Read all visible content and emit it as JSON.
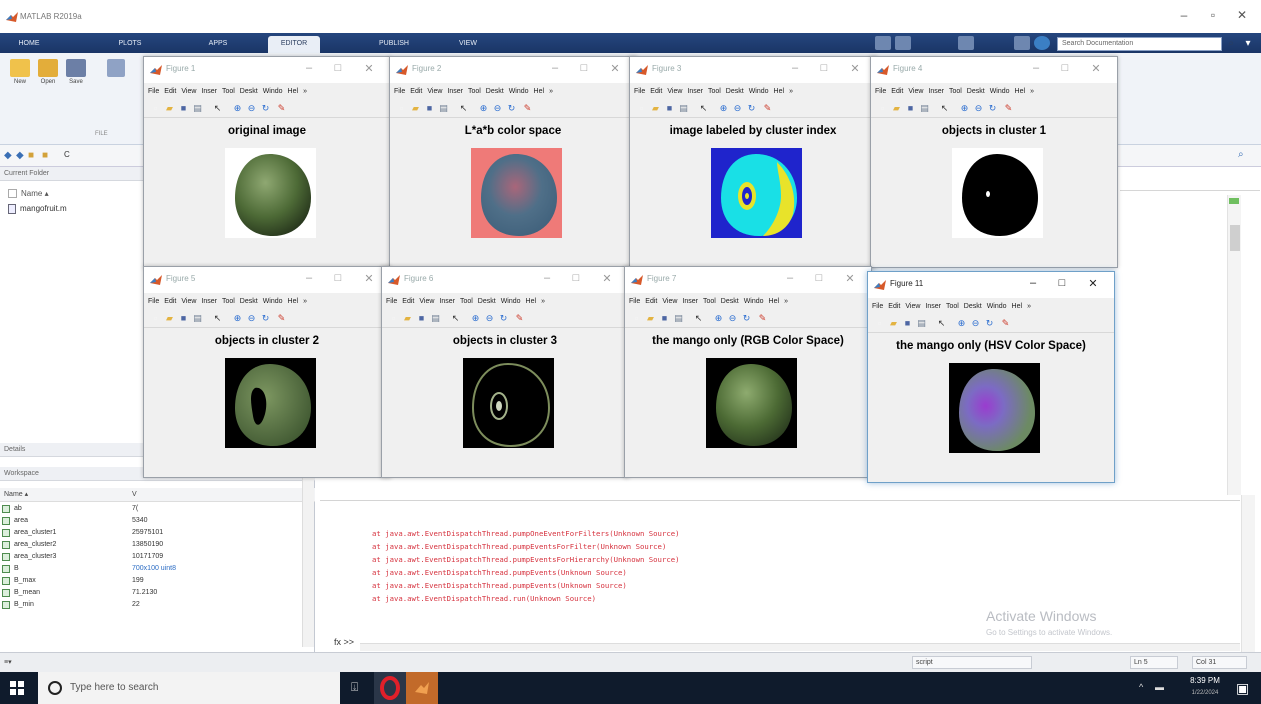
{
  "window": {
    "title": "MATLAB R2019a"
  },
  "toolstrip_tabs": [
    "HOME",
    "PLOTS",
    "APPS",
    "EDITOR",
    "PUBLISH",
    "VIEW"
  ],
  "search": {
    "placeholder": "Search Documentation"
  },
  "toolstrip": {
    "new": "New",
    "open": "Open",
    "save": "Save",
    "file_group": "FILE"
  },
  "address": {
    "path": "C"
  },
  "current_folder": {
    "header": "Current Folder",
    "name_col": "Name ▴",
    "file": "mangofruit.m"
  },
  "details": {
    "header": "Details"
  },
  "workspace": {
    "header": "Workspace",
    "name_col": "Name ▴",
    "value_col": "V",
    "rows": [
      {
        "name": "ab",
        "value": "7("
      },
      {
        "name": "area",
        "value": "5340"
      },
      {
        "name": "area_cluster1",
        "value": "25975101"
      },
      {
        "name": "area_cluster2",
        "value": "13850190"
      },
      {
        "name": "area_cluster3",
        "value": "10171709"
      },
      {
        "name": "B",
        "value": "700x100 uint8"
      },
      {
        "name": "B_max",
        "value": "199"
      },
      {
        "name": "B_mean",
        "value": "71.2130"
      },
      {
        "name": "B_min",
        "value": "22"
      }
    ]
  },
  "command_window": {
    "lines": [
      "at java.awt.EventDispatchThread.pumpOneEventForFilters(Unknown Source)",
      "at java.awt.EventDispatchThread.pumpEventsForFilter(Unknown Source)",
      "at java.awt.EventDispatchThread.pumpEventsForHierarchy(Unknown Source)",
      "at java.awt.EventDispatchThread.pumpEvents(Unknown Source)",
      "at java.awt.EventDispatchThread.pumpEvents(Unknown Source)",
      "at java.awt.EventDispatchThread.run(Unknown Source)"
    ],
    "prompt": "fx >>"
  },
  "watermark": {
    "line1": "Activate Windows",
    "line2": "Go to Settings to activate Windows."
  },
  "statusbar": {
    "mode": "script",
    "line": "Ln  5",
    "col": "Col  31"
  },
  "figure_menu": [
    "File",
    "Edit",
    "View",
    "Inser",
    "Tool",
    "Deskt",
    "Windo",
    "Hel"
  ],
  "figures": [
    {
      "name": "Figure 1",
      "title": "original image"
    },
    {
      "name": "Figure 2",
      "title": "L*a*b color space"
    },
    {
      "name": "Figure 3",
      "title": "image labeled by cluster index"
    },
    {
      "name": "Figure 4",
      "title": "objects in cluster 1"
    },
    {
      "name": "Figure 5",
      "title": "objects in cluster 2"
    },
    {
      "name": "Figure 6",
      "title": "objects in cluster 3"
    },
    {
      "name": "Figure 7",
      "title": "the mango only (RGB Color Space)"
    },
    {
      "name": "Figure 11",
      "title": "the mango only (HSV Color Space)"
    }
  ],
  "taskbar": {
    "search_placeholder": "Type here to search",
    "time": "8:39 PM",
    "date": "1/22/2024"
  },
  "colors": {
    "matlab_tab": "#1a3566",
    "command_error": "#d6323e",
    "taskbar": "#0f1b2c"
  }
}
